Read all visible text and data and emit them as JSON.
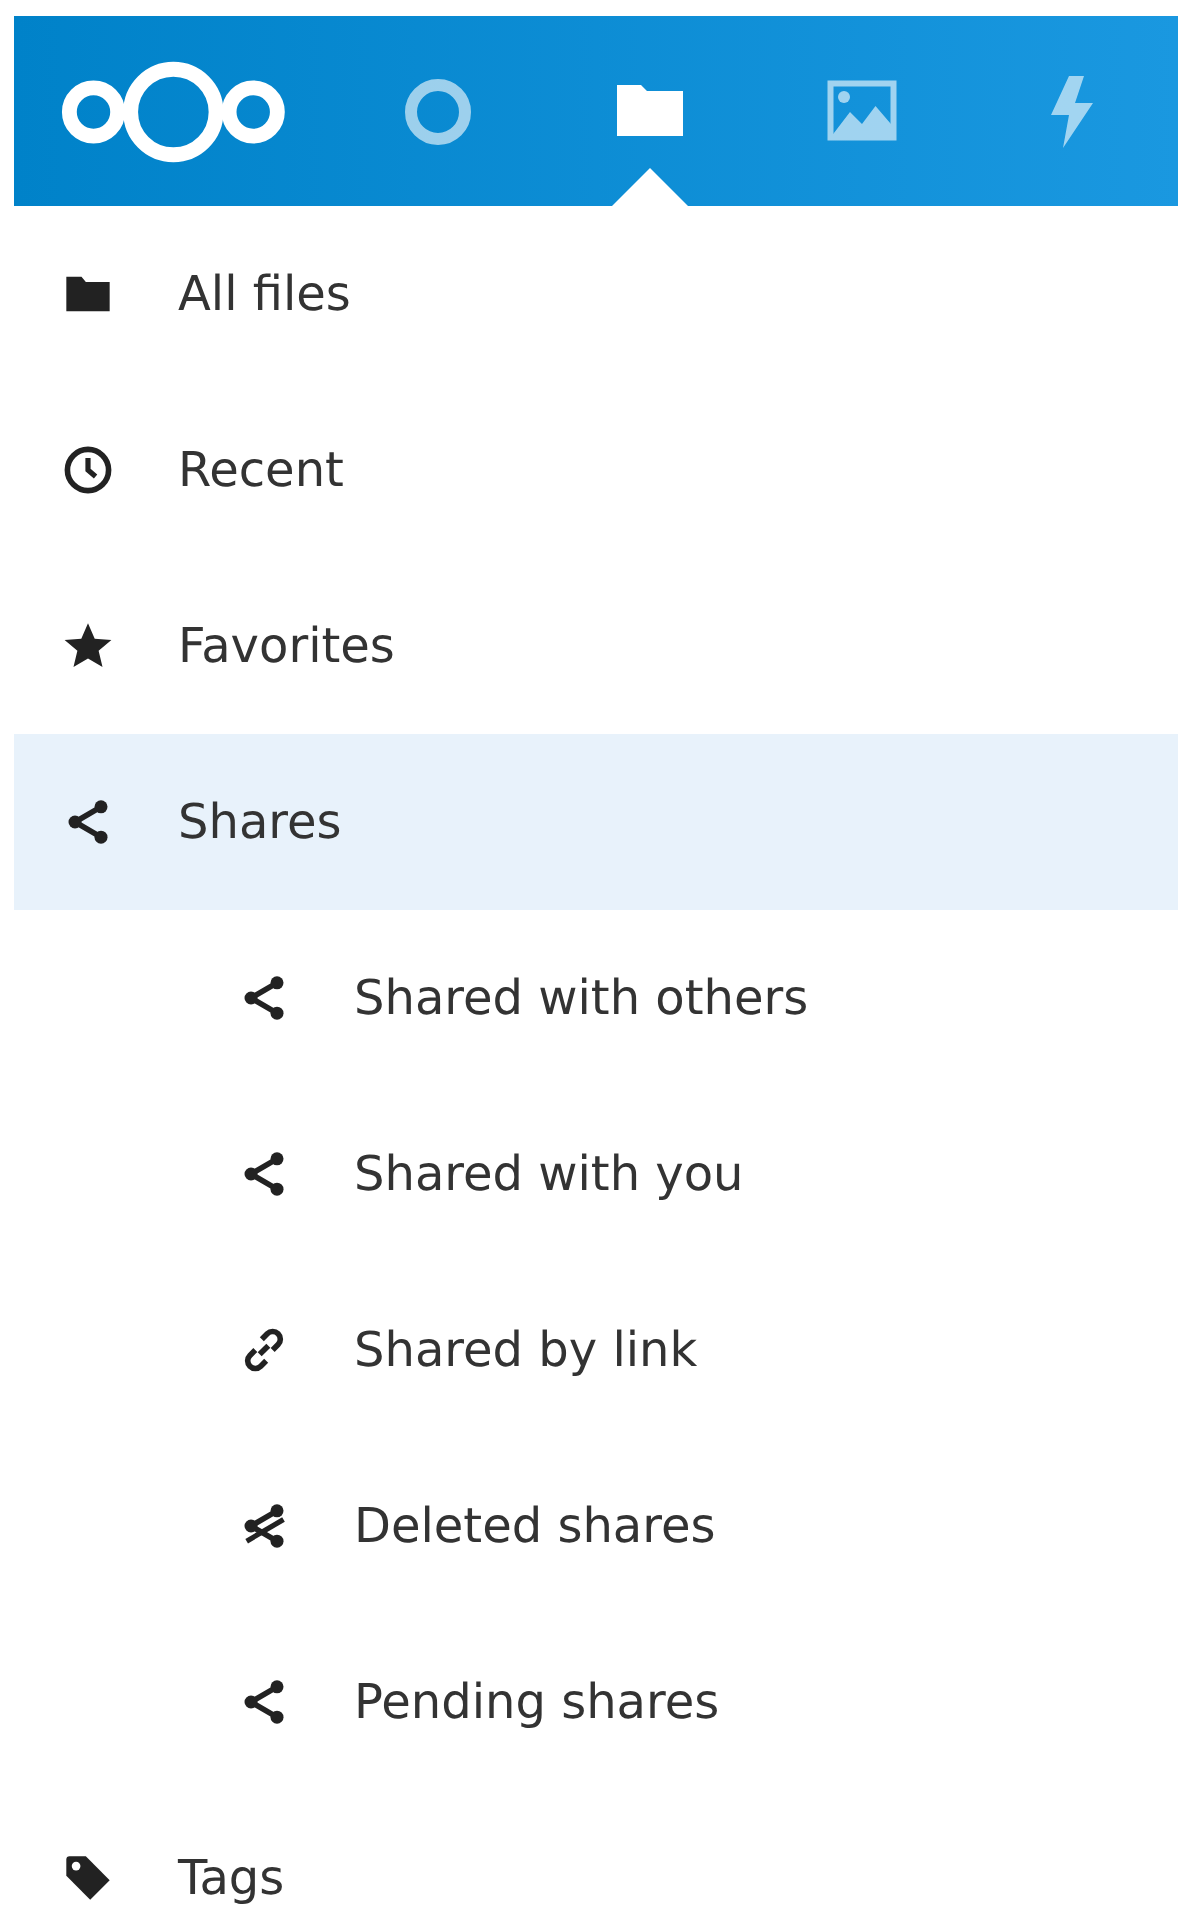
{
  "header": {
    "apps": [
      {
        "selected": false
      },
      {
        "selected": true
      },
      {
        "selected": false
      },
      {
        "selected": false
      }
    ]
  },
  "sidebar": {
    "items": [
      {
        "label": "All files",
        "selected": false
      },
      {
        "label": "Recent",
        "selected": false
      },
      {
        "label": "Favorites",
        "selected": false
      },
      {
        "label": "Shares",
        "selected": true,
        "children": [
          {
            "label": "Shared with others"
          },
          {
            "label": "Shared with you"
          },
          {
            "label": "Shared by link"
          },
          {
            "label": "Deleted shares"
          },
          {
            "label": "Pending shares"
          }
        ]
      },
      {
        "label": "Tags",
        "selected": false
      }
    ]
  }
}
